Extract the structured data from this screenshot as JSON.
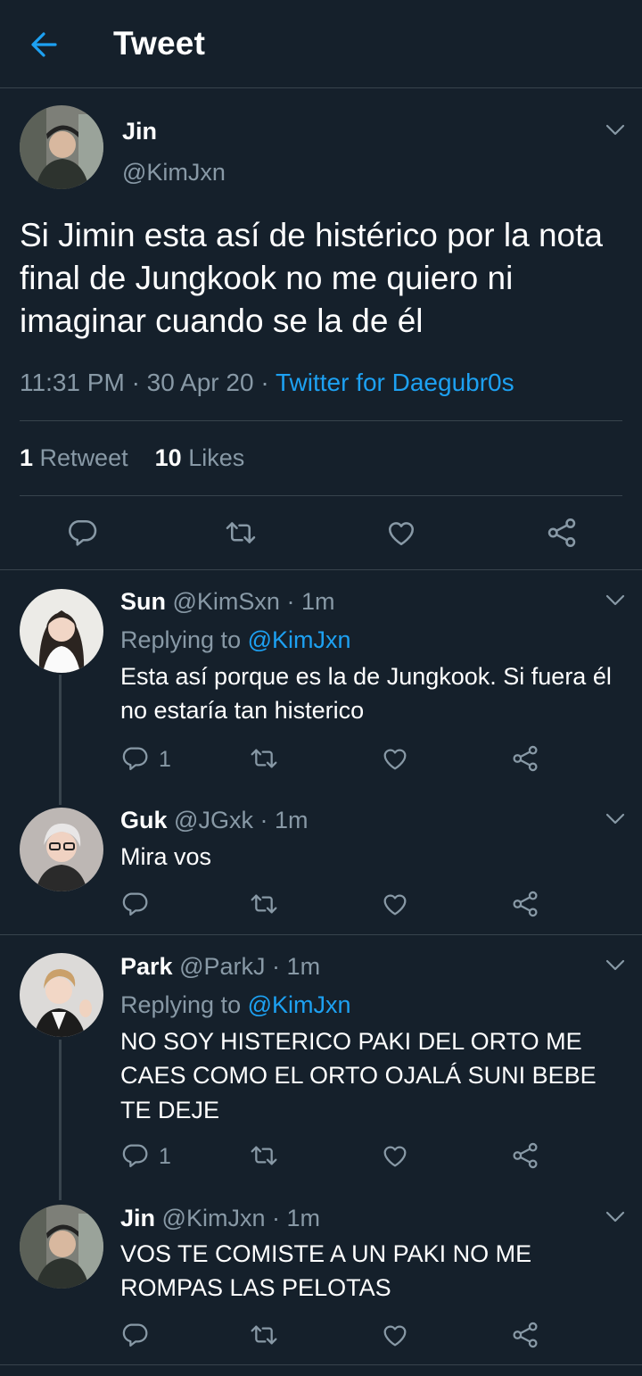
{
  "header": {
    "title": "Tweet"
  },
  "main_tweet": {
    "name": "Jin",
    "handle": "@KimJxn",
    "text": "Si Jimin esta así de histérico por la nota final de Jungkook no me quiero ni imaginar cuando se la de él",
    "time": "11:31 PM",
    "date": "30 Apr 20",
    "source": "Twitter for Daegubr0s",
    "retweets_count": "1",
    "retweets_label": "Retweet",
    "likes_count": "10",
    "likes_label": "Likes"
  },
  "replies": [
    {
      "name": "Sun",
      "handle": "@KimSxn",
      "time": "1m",
      "replying_label": "Replying to",
      "replying_to": "@KimJxn",
      "text": "Esta así porque es la de Jungkook. Si fuera él no estaría tan histerico",
      "reply_count": "1"
    },
    {
      "name": "Guk",
      "handle": "@JGxk",
      "time": "1m",
      "text": "Mira vos"
    },
    {
      "name": "Park",
      "handle": "@ParkJ",
      "time": "1m",
      "replying_label": "Replying to",
      "replying_to": "@KimJxn",
      "text": "NO SOY HISTERICO PAKI DEL ORTO ME CAES COMO EL ORTO OJALÁ SUNI BEBE TE DEJE",
      "reply_count": "1"
    },
    {
      "name": "Jin",
      "handle": "@KimJxn",
      "time": "1m",
      "text": "VOS TE COMISTE A UN PAKI NO ME ROMPAS LAS PELOTAS"
    }
  ],
  "separator": "·",
  "colors": {
    "background": "#15202b",
    "accent": "#1da1f2",
    "muted": "#8899a6",
    "divider": "#38444d"
  },
  "icons": [
    "back-arrow-icon",
    "chevron-down-icon",
    "reply-icon",
    "retweet-icon",
    "like-icon",
    "share-icon"
  ]
}
